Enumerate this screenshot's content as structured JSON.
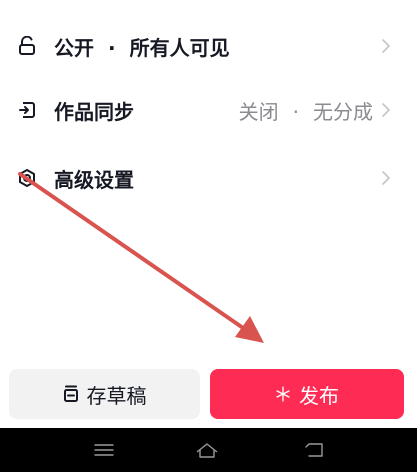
{
  "settings": {
    "privacy": {
      "label": "公开",
      "separator": "·",
      "value": "所有人可见"
    },
    "sync": {
      "label": "作品同步",
      "value": "关闭",
      "separator": "·",
      "value2": "无分成"
    },
    "advanced": {
      "label": "高级设置"
    }
  },
  "actions": {
    "draft_label": "存草稿",
    "publish_label": "发布"
  },
  "icons": {
    "privacy": "unlock-icon",
    "sync": "sync-icon",
    "advanced": "settings-icon",
    "chevron": "chevron-right-icon",
    "draft": "draft-box-icon",
    "publish": "sparkle-icon"
  },
  "colors": {
    "accent": "#fe2c55",
    "arrow": "#d9534f",
    "text": "#161823",
    "muted": "#8a8b91"
  }
}
